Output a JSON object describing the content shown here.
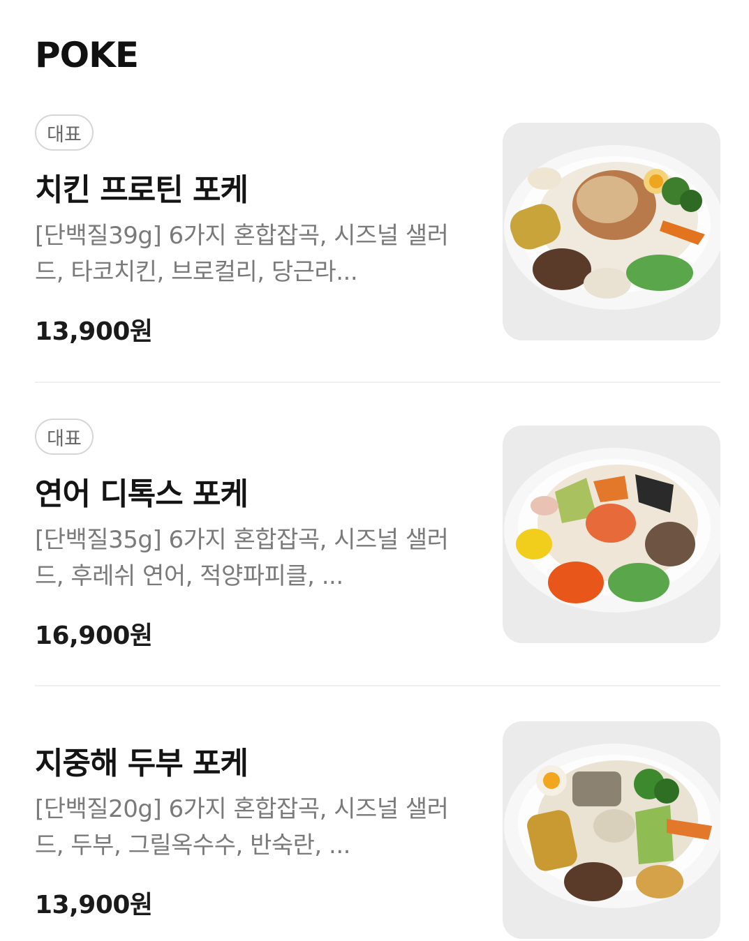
{
  "section": {
    "title": "POKE"
  },
  "items": [
    {
      "badge": "대표",
      "name": "치킨 프로틴 포케",
      "description": "[단백질39g] 6가지 혼합잡곡, 시즈널 샐러드, 타코치킨, 브로컬리, 당근라...",
      "price": "13,900원",
      "image": "chicken-protein-poke-bowl-photo"
    },
    {
      "badge": "대표",
      "name": "연어 디톡스 포케",
      "description": "[단백질35g] 6가지 혼합잡곡, 시즈널 샐러드, 후레쉬 연어, 적양파피클, ...",
      "price": "16,900원",
      "image": "salmon-detox-poke-bowl-photo"
    },
    {
      "name": "지중해 두부 포케",
      "description": "[단백질20g] 6가지 혼합잡곡, 시즈널 샐러드, 두부, 그릴옥수수, 반숙란, ...",
      "price": "13,900원",
      "image": "mediterranean-tofu-poke-bowl-photo"
    }
  ]
}
